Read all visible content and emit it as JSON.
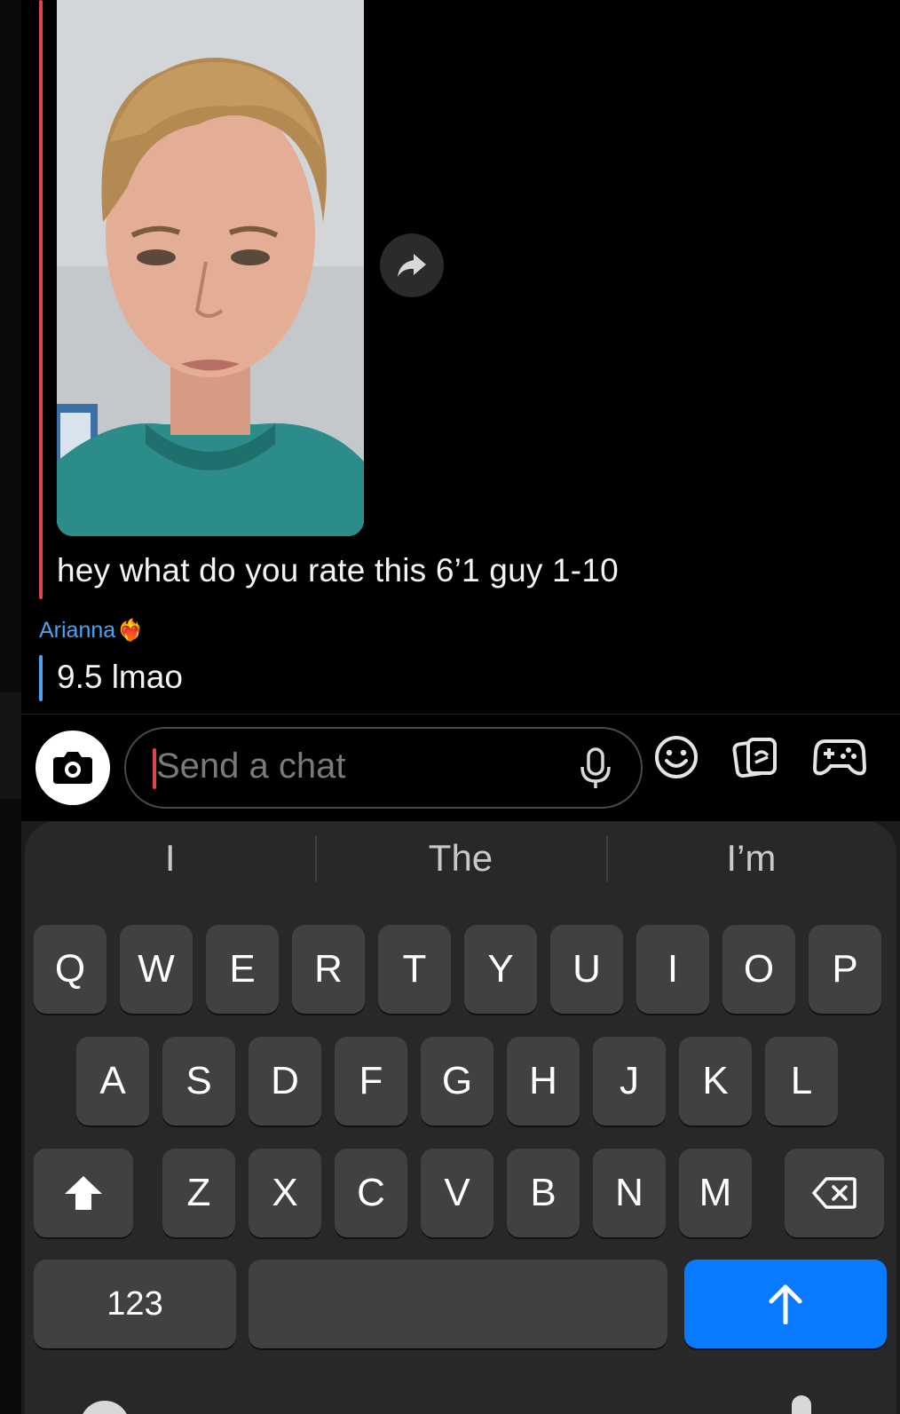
{
  "conversation": {
    "shared_message_text": "hey what do you rate this 6’1 guy 1-10",
    "reply": {
      "sender_name": "Arianna",
      "sender_emoji": "❤️‍🔥",
      "text": "9.5 lmao"
    }
  },
  "composer": {
    "placeholder": "Send a chat",
    "icons": [
      "camera-icon",
      "microphone-icon",
      "emoji-icon",
      "stickers-icon",
      "games-icon"
    ]
  },
  "keyboard": {
    "suggestions": [
      "I",
      "The",
      "I’m"
    ],
    "row1": [
      "Q",
      "W",
      "E",
      "R",
      "T",
      "Y",
      "U",
      "I",
      "O",
      "P"
    ],
    "row2": [
      "A",
      "S",
      "D",
      "F",
      "G",
      "H",
      "J",
      "K",
      "L"
    ],
    "row3": [
      "Z",
      "X",
      "C",
      "V",
      "B",
      "N",
      "M"
    ],
    "numbers_label": "123"
  },
  "colors": {
    "sender_accent": "#e0424f",
    "reply_accent": "#4aa3f2",
    "send_key": "#0a7bff"
  }
}
